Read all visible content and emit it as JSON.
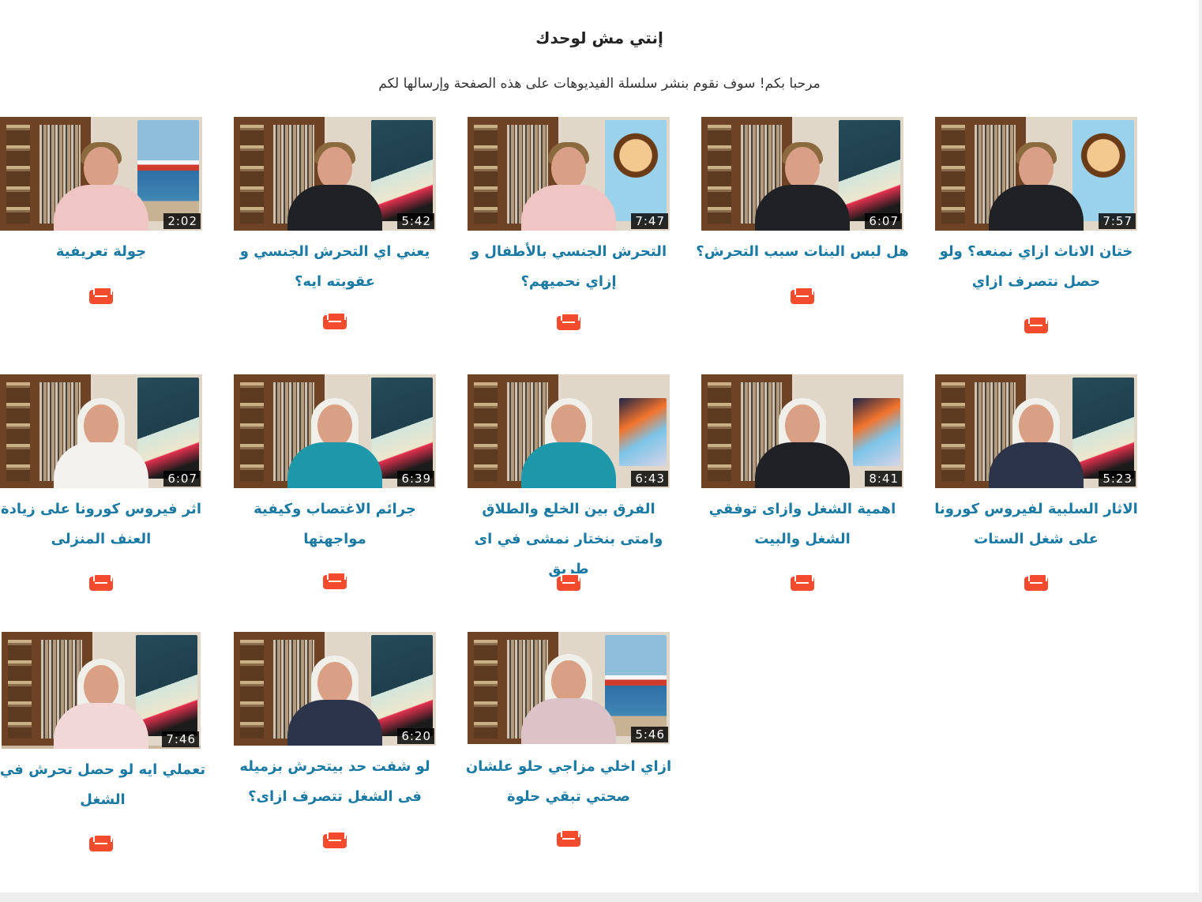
{
  "page": {
    "title": "إنتي مش لوحدك",
    "subtitle": "مرحبا بكم! سوف نقوم بنشر سلسلة الفيديوهات على هذه الصفحة وإرسالها لكم"
  },
  "colors": {
    "title_link": "#1b7aa3",
    "save_icon": "#f24b2e",
    "duration_badge_bg": "#000000"
  },
  "videos": [
    {
      "title": "ختان الاناث ازاي نمنعه؟ ولو حصل نتصرف ازاي",
      "duration": "7:57",
      "icon": "save-tray-icon"
    },
    {
      "title": "هل لبس البنات سبب التحرش؟",
      "duration": "6:07",
      "icon": "save-tray-icon"
    },
    {
      "title": "التحرش الجنسي بالأطفال و إزاي نحميهم؟",
      "duration": "7:47",
      "icon": "save-tray-icon"
    },
    {
      "title": "يعني اي التحرش الجنسي و عقوبته ايه؟",
      "duration": "5:42",
      "icon": "save-tray-icon"
    },
    {
      "title": "جولة تعريفية",
      "duration": "2:02",
      "icon": "save-tray-icon"
    },
    {
      "title": "الاثار السلبية لفيروس كورونا على شغل الستات",
      "duration": "5:23",
      "icon": "save-tray-icon"
    },
    {
      "title": "اهمية الشغل وازاى توفقي الشغل والبيت",
      "duration": "8:41",
      "icon": "save-tray-icon"
    },
    {
      "title": "الفرق بين الخلع والطلاق وامتى بنختار نمشى في اى طريق",
      "duration": "6:43",
      "icon": "save-tray-icon"
    },
    {
      "title": "جرائم الاغتصاب وكيفية مواجهتها",
      "duration": "6:39",
      "icon": "save-tray-icon"
    },
    {
      "title": "اثر فيروس كورونا على زيادة العنف المنزلى",
      "duration": "6:07",
      "icon": "save-tray-icon"
    },
    {
      "title": "ازاي اخلي مزاجي حلو علشان صحتي تبقي حلوة",
      "duration": "5:46",
      "icon": "save-tray-icon"
    },
    {
      "title": "لو شفت حد بيتحرش بزميله فى الشغل تتصرف ازاى؟",
      "duration": "6:20",
      "icon": "save-tray-icon"
    },
    {
      "title": "تعملي ايه لو حصل تحرش في الشغل",
      "duration": "7:46",
      "icon": "save-tray-icon"
    }
  ]
}
